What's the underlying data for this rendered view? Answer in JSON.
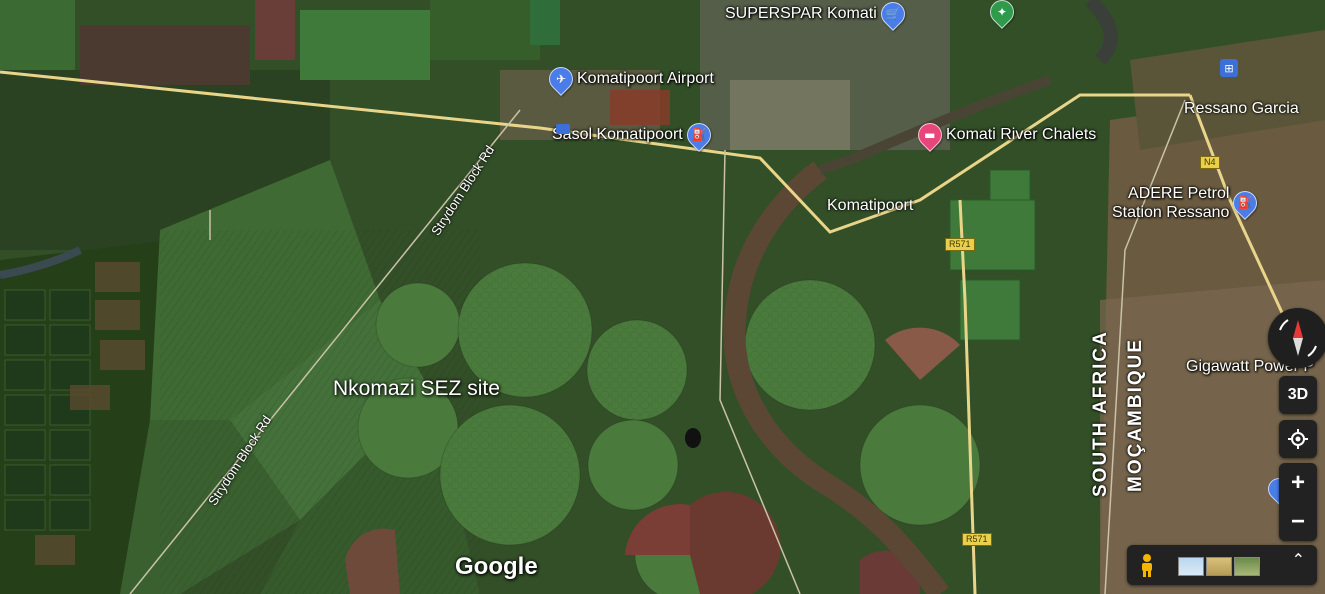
{
  "map": {
    "places": [
      {
        "id": "superspar",
        "label": "SUPERSPAR Komati",
        "icon": "shopping-cart-icon",
        "color": "#4a7de8"
      },
      {
        "id": "airport",
        "label": "Komatipoort Airport",
        "icon": "airplane-icon",
        "color": "#4a7de8"
      },
      {
        "id": "sasol",
        "label": "Sasol Komatipoort",
        "icon": "fuel-pump-icon",
        "color": "#4a7de8"
      },
      {
        "id": "chalets",
        "label": "Komati River Chalets",
        "icon": "bed-icon",
        "color": "#e8457a"
      },
      {
        "id": "adere",
        "label": "ADERE Petrol\nStation Ressano",
        "icon": "fuel-pump-icon",
        "color": "#4a7de8"
      },
      {
        "id": "gigawatt",
        "label": "Gigawatt Power P",
        "icon": "",
        "color": ""
      }
    ],
    "towns": {
      "komatipoort": "Komatipoort",
      "ressano": "Ressano Garcia"
    },
    "roads": {
      "strydom1": "Strydom Block Rd",
      "strydom2": "Strydom Block Rd",
      "r571a": "R571",
      "r571b": "R571",
      "n4": "N4"
    },
    "countries": {
      "south_africa": "SOUTH AFRICA",
      "mozambique": "MOÇAMBIQUE"
    },
    "annotation": "Nkomazi SEZ site",
    "attribution": "Google"
  },
  "controls": {
    "threeD": "3D",
    "zoom_in": "+",
    "zoom_out": "−",
    "expand": "⌃"
  },
  "colors": {
    "poi_blue": "#4a7de8",
    "poi_pink": "#e8457a",
    "river": "#5a4a38",
    "road": "#e9d58a"
  }
}
